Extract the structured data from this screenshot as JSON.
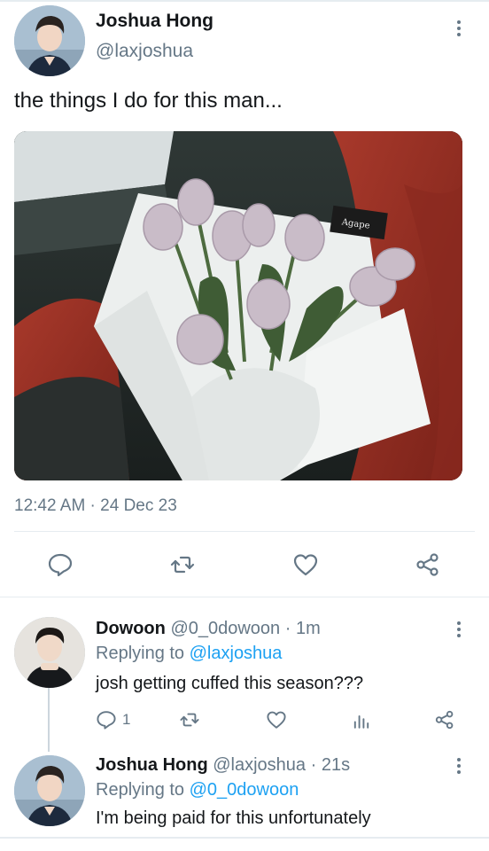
{
  "tweet": {
    "author_name": "Joshua Hong",
    "author_handle": "@laxjoshua",
    "text": "the things I do for this man...",
    "timestamp": "12:42 AM · 24 Dec 23",
    "photo_card_text": "Agape"
  },
  "actions": {
    "icons": [
      "reply-icon",
      "retweet-icon",
      "like-icon",
      "share-icon"
    ]
  },
  "replies": [
    {
      "author_name": "Dowoon",
      "author_handle": "@0_0dowoon",
      "time": "· 1m",
      "replying_prefix": "Replying to",
      "replying_to": "@laxjoshua",
      "text": "josh getting cuffed this season???",
      "reply_count": "1"
    },
    {
      "author_name": "Joshua Hong",
      "author_handle": "@laxjoshua",
      "time": "· 21s",
      "replying_prefix": "Replying to",
      "replying_to": "@0_0dowoon",
      "text": "I'm being paid for this unfortunately"
    }
  ],
  "colors": {
    "link": "#1da1f2",
    "secondary_text": "#657786",
    "divider": "#e6ecf0"
  }
}
